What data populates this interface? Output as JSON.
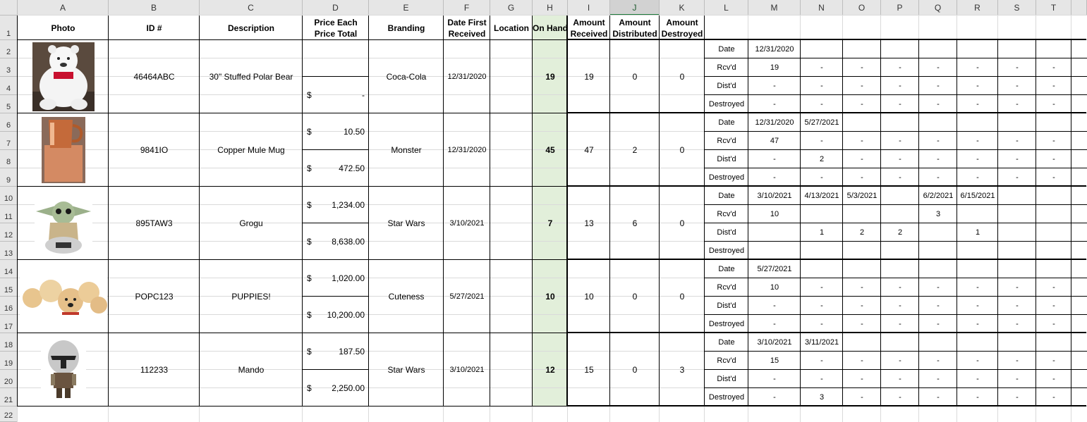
{
  "columns": [
    {
      "label": "A",
      "w": 129
    },
    {
      "label": "B",
      "w": 129
    },
    {
      "label": "C",
      "w": 146
    },
    {
      "label": "D",
      "w": 94
    },
    {
      "label": "E",
      "w": 106
    },
    {
      "label": "F",
      "w": 66
    },
    {
      "label": "G",
      "w": 60
    },
    {
      "label": "H",
      "w": 50
    },
    {
      "label": "I",
      "w": 60
    },
    {
      "label": "J",
      "w": 70
    },
    {
      "label": "K",
      "w": 64
    },
    {
      "label": "L",
      "w": 62
    },
    {
      "label": "M",
      "w": 74
    },
    {
      "label": "N",
      "w": 60
    },
    {
      "label": "O",
      "w": 54
    },
    {
      "label": "P",
      "w": 54
    },
    {
      "label": "Q",
      "w": 54
    },
    {
      "label": "R",
      "w": 58
    },
    {
      "label": "S",
      "w": 54
    },
    {
      "label": "T",
      "w": 50
    }
  ],
  "selected_column": "J",
  "row_labels": [
    "1",
    "2",
    "3",
    "4",
    "5",
    "6",
    "7",
    "8",
    "9",
    "10",
    "11",
    "12",
    "13",
    "14",
    "15",
    "16",
    "17",
    "18",
    "19",
    "20",
    "21",
    "22"
  ],
  "headers": {
    "photo": "Photo",
    "id": "ID #",
    "description": "Description",
    "price": "Price Each Price Total",
    "branding": "Branding",
    "date_first": "Date First Received",
    "location": "Location",
    "on_hand": "On Hand",
    "received": "Amount Received",
    "distributed": "Amount Distributed",
    "destroyed": "Amount Destroyed"
  },
  "tracker_labels": [
    "Date",
    "Rcv'd",
    "Dist'd",
    "Destroyed"
  ],
  "colors": {
    "on_hand_fill": "#e2efda",
    "header_bg": "#e6e6e6",
    "selected_header_accent": "#1d7a3a"
  },
  "items": [
    {
      "photo": "polar-bear-plush",
      "id": "46464ABC",
      "description": "30\" Stuffed Polar Bear",
      "price_each": "",
      "price_each_dollar": "",
      "price_total": "-",
      "price_total_dollar": "$",
      "branding": "Coca-Cola",
      "date_first": "12/31/2020",
      "location": "",
      "on_hand": "19",
      "received": "19",
      "distributed": "0",
      "destroyed": "0",
      "tracker": [
        [
          "12/31/2020",
          "",
          "",
          "",
          "",
          "",
          "",
          ""
        ],
        [
          "19",
          "-",
          "-",
          "-",
          "-",
          "-",
          "-",
          "-"
        ],
        [
          "-",
          "-",
          "-",
          "-",
          "-",
          "-",
          "-",
          "-"
        ],
        [
          "-",
          "-",
          "-",
          "-",
          "-",
          "-",
          "-",
          "-"
        ]
      ]
    },
    {
      "photo": "copper-mug",
      "id": "9841IO",
      "description": "Copper Mule Mug",
      "price_each": "10.50",
      "price_each_dollar": "$",
      "price_total": "472.50",
      "price_total_dollar": "$",
      "branding": "Monster",
      "date_first": "12/31/2020",
      "location": "",
      "on_hand": "45",
      "received": "47",
      "distributed": "2",
      "destroyed": "0",
      "tracker": [
        [
          "12/31/2020",
          "5/27/2021",
          "",
          "",
          "",
          "",
          "",
          ""
        ],
        [
          "47",
          "-",
          "-",
          "-",
          "-",
          "-",
          "-",
          "-"
        ],
        [
          "-",
          "2",
          "-",
          "-",
          "-",
          "-",
          "-",
          "-"
        ],
        [
          "-",
          "-",
          "-",
          "-",
          "-",
          "-",
          "-",
          "-"
        ]
      ]
    },
    {
      "photo": "grogu-figure",
      "id": "895TAW3",
      "description": "Grogu",
      "price_each": "1,234.00",
      "price_each_dollar": "$",
      "price_total": "8,638.00",
      "price_total_dollar": "$",
      "branding": "Star Wars",
      "date_first": "3/10/2021",
      "location": "",
      "on_hand": "7",
      "received": "13",
      "distributed": "6",
      "destroyed": "0",
      "tracker": [
        [
          "3/10/2021",
          "4/13/2021",
          "5/3/2021",
          "",
          "6/2/2021",
          "6/15/2021",
          "",
          ""
        ],
        [
          "10",
          "",
          "",
          "",
          "3",
          "",
          "",
          ""
        ],
        [
          "",
          "1",
          "2",
          "2",
          "",
          "1",
          "",
          ""
        ],
        [
          "",
          "",
          "",
          "",
          "",
          "",
          "",
          ""
        ]
      ]
    },
    {
      "photo": "puppies",
      "id": "POPC123",
      "description": "PUPPIES!",
      "price_each": "1,020.00",
      "price_each_dollar": "$",
      "price_total": "10,200.00",
      "price_total_dollar": "$",
      "branding": "Cuteness",
      "date_first": "5/27/2021",
      "location": "",
      "on_hand": "10",
      "received": "10",
      "distributed": "0",
      "destroyed": "0",
      "tracker": [
        [
          "5/27/2021",
          "",
          "",
          "",
          "",
          "",
          "",
          ""
        ],
        [
          "10",
          "-",
          "-",
          "-",
          "-",
          "-",
          "-",
          "-"
        ],
        [
          "-",
          "-",
          "-",
          "-",
          "-",
          "-",
          "-",
          "-"
        ],
        [
          "-",
          "-",
          "-",
          "-",
          "-",
          "-",
          "-",
          "-"
        ]
      ]
    },
    {
      "photo": "mando-figure",
      "id": "112233",
      "description": "Mando",
      "price_each": "187.50",
      "price_each_dollar": "$",
      "price_total": "2,250.00",
      "price_total_dollar": "$",
      "branding": "Star Wars",
      "date_first": "3/10/2021",
      "location": "",
      "on_hand": "12",
      "received": "15",
      "distributed": "0",
      "destroyed": "3",
      "tracker": [
        [
          "3/10/2021",
          "3/11/2021",
          "",
          "",
          "",
          "",
          "",
          ""
        ],
        [
          "15",
          "-",
          "-",
          "-",
          "-",
          "-",
          "-",
          "-"
        ],
        [
          "-",
          "-",
          "-",
          "-",
          "-",
          "-",
          "-",
          "-"
        ],
        [
          "-",
          "3",
          "-",
          "-",
          "-",
          "-",
          "-",
          "-"
        ]
      ]
    }
  ]
}
